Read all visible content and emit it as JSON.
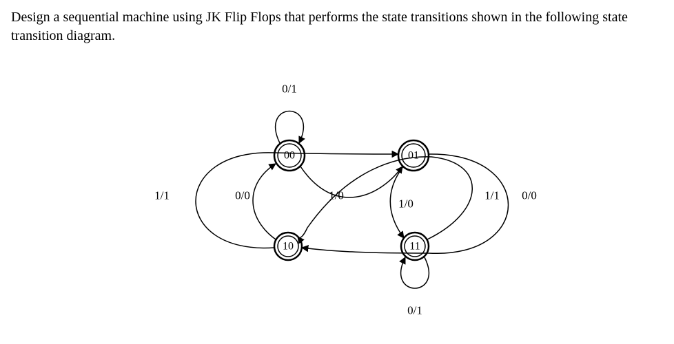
{
  "problem": {
    "text": "Design a sequential machine using JK Flip Flops that performs the state transitions shown in the following state transition diagram."
  },
  "diagram": {
    "states": {
      "s00": "00",
      "s01": "01",
      "s10": "10",
      "s11": "11"
    },
    "transitions": {
      "t00_00": "0/1",
      "t00_01": "1/0",
      "t01_11": "1/0",
      "t01_10": "0/0",
      "t10_00": "0/0",
      "t10_01": "1/1",
      "t11_11": "0/1",
      "t11_10": "1/1"
    }
  }
}
